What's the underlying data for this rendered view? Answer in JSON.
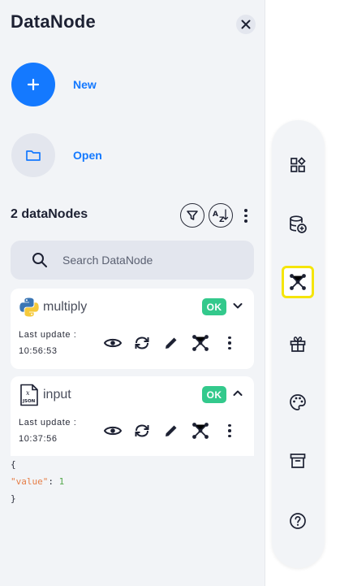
{
  "app": {
    "title": "DataNode"
  },
  "actions": {
    "new_label": "New",
    "open_label": "Open"
  },
  "list": {
    "count_label": "2 dataNodes"
  },
  "search": {
    "placeholder": "Search DataNode"
  },
  "nodes": [
    {
      "name": "multiply",
      "status": "OK",
      "last_update_label": "Last update :",
      "time": "10:56:53",
      "icon": "python-icon",
      "expanded": false
    },
    {
      "name": "input",
      "status": "OK",
      "last_update_label": "Last update :",
      "time": "10:37:56",
      "icon": "json-file-icon",
      "expanded": true
    }
  ],
  "content": {
    "open_brace": "{",
    "key": "\"value\"",
    "colon": ":",
    "value": "1",
    "close_brace": "}"
  },
  "rail": {
    "items": [
      "widgets-icon",
      "database-add-icon",
      "scenario-graph-icon",
      "cycle-box-icon",
      "palette-icon",
      "archive-icon",
      "help-icon"
    ],
    "active": "scenario-graph-icon",
    "highlight_color": "#f5e50a"
  },
  "colors": {
    "accent": "#1479ff",
    "ok": "#33c98c",
    "panel": "#f2f4f7"
  }
}
